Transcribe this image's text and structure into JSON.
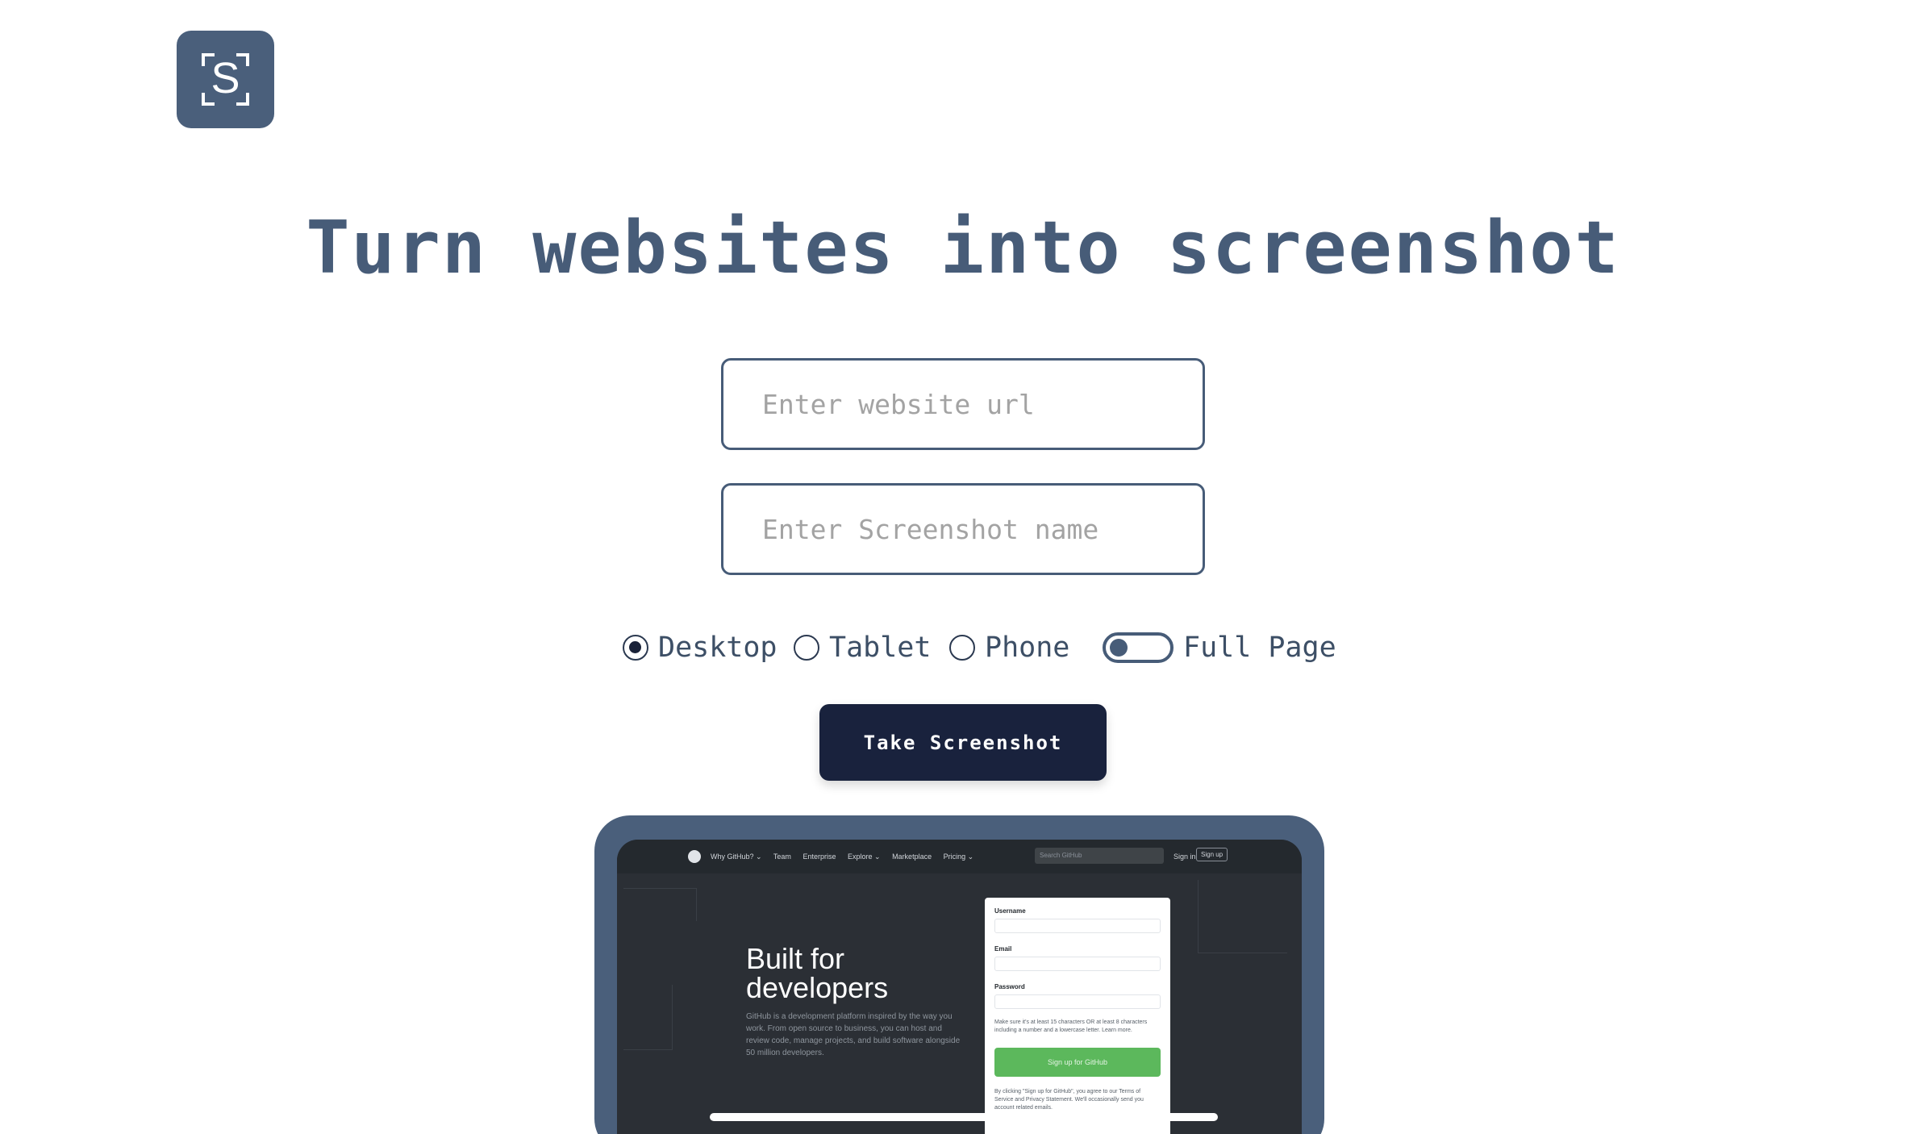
{
  "logo": {
    "letter": "S",
    "icon": "screenshot-logo-icon"
  },
  "headline": "Turn websites into screenshot",
  "inputs": {
    "url_placeholder": "Enter website url",
    "url_value": "",
    "name_placeholder": "Enter Screenshot name",
    "name_value": ""
  },
  "device_options": [
    {
      "label": "Desktop",
      "checked": true
    },
    {
      "label": "Tablet",
      "checked": false
    },
    {
      "label": "Phone",
      "checked": false
    }
  ],
  "full_page": {
    "label": "Full Page",
    "enabled": false
  },
  "button_label": "Take Screenshot",
  "preview": {
    "nav_links": [
      "Why GitHub? ⌄",
      "Team",
      "Enterprise",
      "Explore ⌄",
      "Marketplace",
      "Pricing ⌄"
    ],
    "search_placeholder": "Search GitHub",
    "sign_in": "Sign in",
    "sign_up": "Sign up",
    "hero_title": "Built for developers",
    "hero_text": "GitHub is a development platform inspired by the way you work. From open source to business, you can host and review code, manage projects, and build software alongside 50 million developers.",
    "form": {
      "username_label": "Username",
      "email_label": "Email",
      "password_label": "Password",
      "password_note": "Make sure it's at least 15 characters OR at least 8 characters including a number and a lowercase letter. Learn more.",
      "submit": "Sign up for GitHub",
      "terms": "By clicking \"Sign up for GitHub\", you agree to our Terms of Service and Privacy Statement. We'll occasionally send you account related emails."
    }
  },
  "colors": {
    "primary": "#475c78",
    "button": "#19223d",
    "background": "#ffffff"
  }
}
